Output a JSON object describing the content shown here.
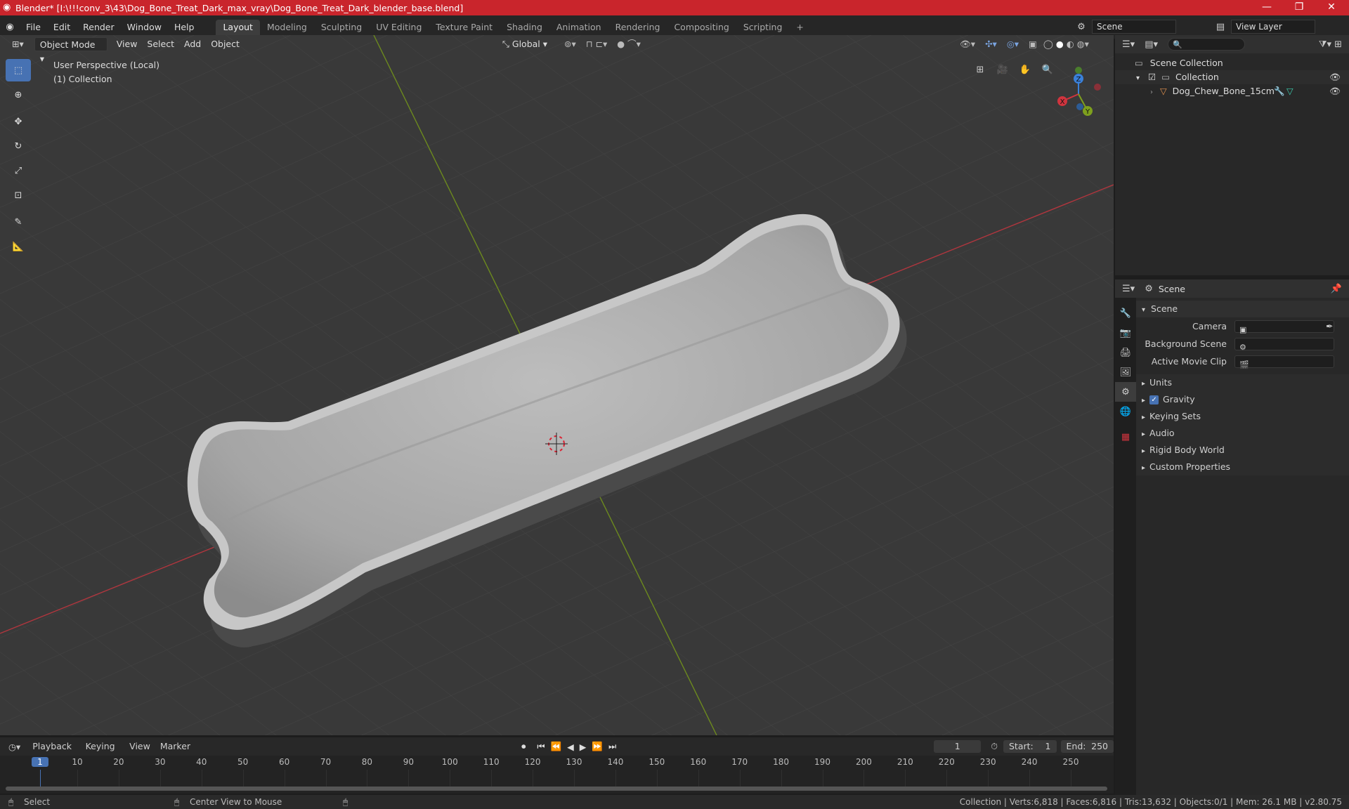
{
  "titlebar": {
    "title": "Blender* [I:\\!!!conv_3\\43\\Dog_Bone_Treat_Dark_max_vray\\Dog_Bone_Treat_Dark_blender_base.blend]",
    "minimize": "—",
    "maximize": "❐",
    "close": "✕"
  },
  "menubar": {
    "menus": [
      "File",
      "Edit",
      "Render",
      "Window",
      "Help"
    ],
    "workspaces": [
      "Layout",
      "Modeling",
      "Sculpting",
      "UV Editing",
      "Texture Paint",
      "Shading",
      "Animation",
      "Rendering",
      "Compositing",
      "Scripting"
    ],
    "active_workspace": "Layout",
    "add_tab": "+",
    "scene_label": "Scene",
    "view_layer_label": "View Layer"
  },
  "viewport_header": {
    "mode": "Object Mode",
    "menus": [
      "View",
      "Select",
      "Add",
      "Object"
    ],
    "transform_orientation": "Global"
  },
  "viewport": {
    "perspective_label": "User Perspective (Local)",
    "collection_label": "(1) Collection",
    "gizmo": {
      "x": "X",
      "y": "Y",
      "z": "Z"
    }
  },
  "outliner": {
    "search_placeholder": "",
    "rows": [
      {
        "label": "Scene Collection"
      },
      {
        "label": "Collection"
      },
      {
        "label": "Dog_Chew_Bone_15cm"
      }
    ]
  },
  "properties": {
    "header_title": "Scene",
    "panel_title": "Scene",
    "fields": [
      {
        "label": "Camera",
        "value": ""
      },
      {
        "label": "Background Scene",
        "value": ""
      },
      {
        "label": "Active Movie Clip",
        "value": ""
      }
    ],
    "sections": [
      "Units",
      "Gravity",
      "Keying Sets",
      "Audio",
      "Rigid Body World",
      "Custom Properties"
    ],
    "gravity_checked": true
  },
  "timeline": {
    "menus": [
      "Playback",
      "Keying",
      "View",
      "Marker"
    ],
    "current_frame": "1",
    "start_label": "Start:",
    "start_value": "1",
    "end_label": "End:",
    "end_value": "250",
    "ruler_ticks": [
      "1",
      "10",
      "20",
      "30",
      "40",
      "50",
      "60",
      "70",
      "80",
      "90",
      "100",
      "110",
      "120",
      "130",
      "140",
      "150",
      "160",
      "170",
      "180",
      "190",
      "200",
      "210",
      "220",
      "230",
      "240",
      "250"
    ]
  },
  "statusbar": {
    "left_hint": "Select",
    "middle_hint": "Center View to Mouse",
    "stats": "Collection | Verts:6,818 | Faces:6,816 | Tris:13,632 | Objects:0/1 | Mem: 26.1 MB | v2.80.75"
  },
  "colors": {
    "accent": "#4772b3",
    "titlebar": "#c9252c",
    "x_axis": "#d0343e",
    "y_axis": "#7ea01e",
    "z_axis": "#3a80d9"
  }
}
